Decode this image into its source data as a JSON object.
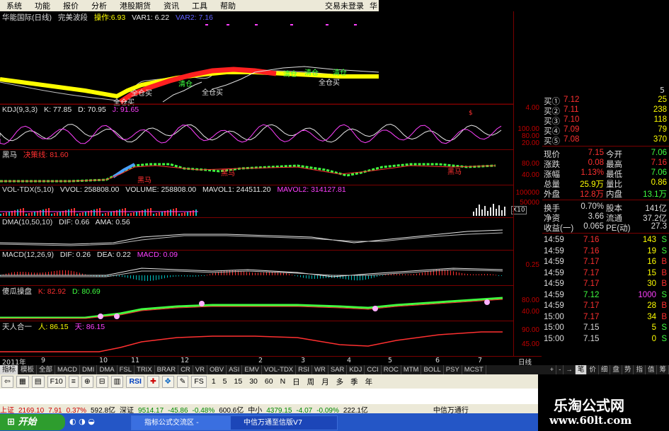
{
  "menu": {
    "items": [
      "系统",
      "功能",
      "报价",
      "分析",
      "港股期货",
      "资讯",
      "工具",
      "帮助"
    ],
    "right": "交易未登录",
    "right2": "华"
  },
  "pane_main": {
    "name": "华能国际(日线)",
    "ind": "完美波段",
    "op_label": "操作:",
    "op_val": "6.93",
    "var1": "VAR1: 6.22",
    "var2": "VAR2: 7.16",
    "ann": [
      "全仓买",
      "全仓买",
      "清仓",
      "清仓",
      "清仓",
      "清仓",
      "全仓买",
      "全仓买"
    ]
  },
  "pane_kdj": {
    "name": "KDJ(9,3,3)",
    "k": "K: 77.85",
    "d": "D: 70.95",
    "j": "J: 91.65",
    "y": [
      "4.00",
      "100.00",
      "80.00",
      "20.00"
    ]
  },
  "pane_hm": {
    "name": "黑马",
    "sub": "决策线: 81.60",
    "ann": [
      "黑马",
      "黑马",
      "黑马"
    ],
    "y": [
      "80.00",
      "40.00"
    ]
  },
  "pane_vol": {
    "name": "VOL-TDX(5,10)",
    "vvol": "VVOL: 258808.00",
    "volume": "VOLUME: 258808.00",
    "mavol1": "MAVOL1: 244511.20",
    "mavol2": "MAVOL2: 314127.81",
    "y": [
      "100000",
      "50000"
    ],
    "unit": "X10"
  },
  "pane_dma": {
    "name": "DMA(10,50,10)",
    "dif": "DIF: 0.66",
    "ama": "AMA: 0.56"
  },
  "pane_macd": {
    "name": "MACD(12,26,9)",
    "dif": "DIF: 0.26",
    "dea": "DEA: 0.22",
    "macd": "MACD: 0.09",
    "y": [
      "0.25"
    ]
  },
  "pane_sg": {
    "name": "傻瓜操盘",
    "k": "K: 82.92",
    "d": "D: 80.69",
    "y": [
      "80.00",
      "40.00"
    ]
  },
  "pane_trh": {
    "name": "天人合一",
    "ren": "人: 86.15",
    "tian": "天: 86.15",
    "y": [
      "90.00",
      "45.00"
    ]
  },
  "xaxis": {
    "labels": [
      "2011年",
      "9",
      "10",
      "11",
      "12",
      "2",
      "3",
      "4",
      "5",
      "6",
      "7"
    ],
    "period": "日线"
  },
  "quote": {
    "bids": [
      {
        "l": "买①",
        "p": "7.12",
        "v": "25"
      },
      {
        "l": "买②",
        "p": "7.11",
        "v": "238"
      },
      {
        "l": "买③",
        "p": "7.10",
        "v": "118"
      },
      {
        "l": "买④",
        "p": "7.09",
        "v": "79"
      },
      {
        "l": "买⑤",
        "p": "7.08",
        "v": "370"
      }
    ],
    "stats": [
      {
        "l1": "现价",
        "v1": "7.15",
        "l2": "今开",
        "v2": "7.06"
      },
      {
        "l1": "涨跌",
        "v1": "0.08",
        "l2": "最高",
        "v2": "7.16"
      },
      {
        "l1": "涨幅",
        "v1": "1.13%",
        "l2": "最低",
        "v2": "7.06"
      },
      {
        "l1": "总量",
        "v1": "25.9万",
        "l2": "量比",
        "v2": "0.86"
      },
      {
        "l1": "外盘",
        "v1": "12.8万",
        "l2": "内盘",
        "v2": "13.1万"
      }
    ],
    "fund": [
      {
        "l1": "换手",
        "v1": "0.70%",
        "l2": "股本",
        "v2": "141亿"
      },
      {
        "l1": "净资",
        "v1": "3.66",
        "l2": "流通",
        "v2": "37.2亿"
      },
      {
        "l1": "收益(一)",
        "v1": "0.065",
        "l2": "PE(动)",
        "v2": "27.3"
      }
    ],
    "ticks": [
      {
        "t": "14:59",
        "p": "7.16",
        "v": "143",
        "s": "S"
      },
      {
        "t": "14:59",
        "p": "7.16",
        "v": "19",
        "s": "S"
      },
      {
        "t": "14:59",
        "p": "7.17",
        "v": "16",
        "s": "B"
      },
      {
        "t": "14:59",
        "p": "7.17",
        "v": "15",
        "s": "B"
      },
      {
        "t": "14:59",
        "p": "7.17",
        "v": "30",
        "s": "B"
      },
      {
        "t": "14:59",
        "p": "7.12",
        "v": "1000",
        "s": "S"
      },
      {
        "t": "14:59",
        "p": "7.17",
        "v": "28",
        "s": "B"
      },
      {
        "t": "15:00",
        "p": "7.17",
        "v": "34",
        "s": "B"
      },
      {
        "t": "15:00",
        "p": "7.15",
        "v": "5",
        "s": "S"
      },
      {
        "t": "15:00",
        "p": "7.15",
        "v": "0",
        "s": "S"
      }
    ],
    "top_v": "5"
  },
  "tabs": {
    "items": [
      "指标",
      "模板",
      "全部",
      "MACD",
      "DMI",
      "DMA",
      "FSL",
      "TRIX",
      "BRAR",
      "CR",
      "VR",
      "OBV",
      "ASI",
      "EMV",
      "VOL-TDX",
      "RSI",
      "WR",
      "SAR",
      "KDJ",
      "CCI",
      "ROC",
      "MTM",
      "BOLL",
      "PSY",
      "MCST"
    ],
    "right": [
      "+",
      "-",
      "→",
      "笔",
      "价",
      "细",
      "盘",
      "势",
      "指",
      "值",
      "筹"
    ]
  },
  "toolbar": {
    "icons": [
      "RSI",
      "FS"
    ],
    "periods": [
      "1",
      "5",
      "15",
      "30",
      "60",
      "N",
      "日",
      "周",
      "月",
      "多",
      "季",
      "年"
    ]
  },
  "ticker": {
    "sh_label": "上证",
    "sh": "2169.10",
    "sh_chg": "7.91",
    "sh_pct": "0.37%",
    "sh_amt": "592.8亿",
    "sz_label": "深证",
    "sz": "9514.17",
    "sz_chg": "-45.86",
    "sz_pct": "-0.48%",
    "sz_amt": "600.6亿",
    "zx_label": "中小",
    "zx": "4379.15",
    "zx_chg": "-4.07",
    "zx_pct": "-0.09%",
    "zx_amt": "222.1亿",
    "broker": "中信万通行"
  },
  "taskbar": {
    "start": "开始",
    "t1": "指标公式交流区 -",
    "t2": "中信万通至信版V7"
  },
  "watermark": {
    "l1": "乐淘公式网",
    "l2": "www.60lt.com"
  },
  "colors": {
    "up": "#ff3030",
    "down": "#00c0c0",
    "white": "#e8e8e8",
    "yellow": "#ffff00",
    "magenta": "#ff40ff",
    "green": "#40ff40",
    "gold": "#e0c000"
  }
}
